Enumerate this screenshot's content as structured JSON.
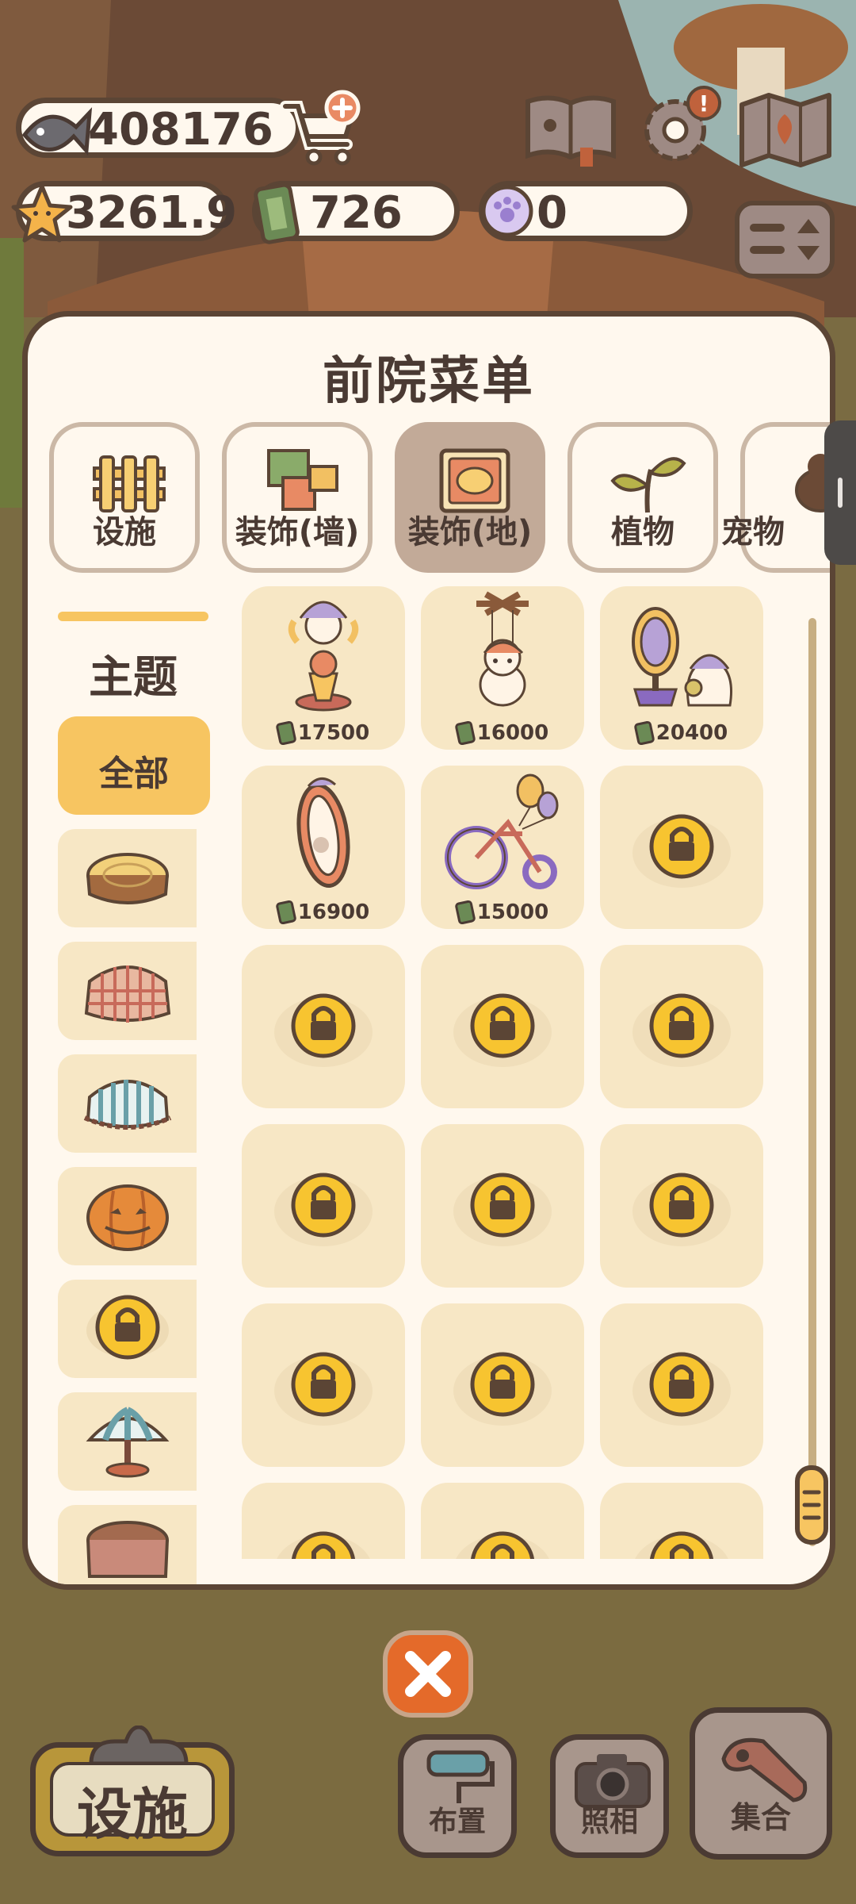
{
  "resources": {
    "fish": {
      "icon": "fish-icon",
      "value": "408176"
    },
    "star": {
      "icon": "star-icon",
      "value": "3261.9"
    },
    "ticket": {
      "icon": "ticket-icon",
      "value": "726"
    },
    "paw": {
      "icon": "paw-coin-icon",
      "value": "0"
    }
  },
  "top_buttons": [
    "shop-cart-button",
    "guide-book-button",
    "settings-button",
    "map-button",
    "sort-toggle-button"
  ],
  "panel": {
    "title": "前院菜单",
    "categories": [
      {
        "label": "设施",
        "icon": "fence-icon",
        "active": false
      },
      {
        "label": "装饰(墙)",
        "icon": "wall-decor-icon",
        "active": false
      },
      {
        "label": "装饰(地)",
        "icon": "rug-icon",
        "active": true
      },
      {
        "label": "植物",
        "icon": "sprout-icon",
        "active": false
      },
      {
        "label": "宠物",
        "icon": "pet-icon",
        "active": false
      }
    ],
    "theme": {
      "title": "主题",
      "items": [
        {
          "label": "全部",
          "icon": "",
          "active": true
        },
        {
          "label": "",
          "icon": "log-table-icon"
        },
        {
          "label": "",
          "icon": "checkered-table-icon"
        },
        {
          "label": "",
          "icon": "striped-table-icon"
        },
        {
          "label": "",
          "icon": "pumpkin-icon"
        },
        {
          "label": "",
          "icon": "lock-icon"
        },
        {
          "label": "",
          "icon": "umbrella-table-icon"
        },
        {
          "label": "",
          "icon": "brown-table-icon"
        }
      ]
    },
    "items": [
      {
        "name": "jester-cat-statue",
        "price": "17500",
        "locked": false
      },
      {
        "name": "puppet-cat",
        "price": "16000",
        "locked": false
      },
      {
        "name": "magic-mirror-ghost",
        "price": "20400",
        "locked": false
      },
      {
        "name": "oval-mirror",
        "price": "16900",
        "locked": false
      },
      {
        "name": "balloon-bicycle",
        "price": "15000",
        "locked": false
      },
      {
        "name": "locked-item",
        "price": "",
        "locked": true
      },
      {
        "name": "locked-item",
        "price": "",
        "locked": true
      },
      {
        "name": "locked-item",
        "price": "",
        "locked": true
      },
      {
        "name": "locked-item",
        "price": "",
        "locked": true
      },
      {
        "name": "locked-item",
        "price": "",
        "locked": true
      },
      {
        "name": "locked-item",
        "price": "",
        "locked": true
      },
      {
        "name": "locked-item",
        "price": "",
        "locked": true
      },
      {
        "name": "locked-item",
        "price": "",
        "locked": true
      },
      {
        "name": "locked-item",
        "price": "",
        "locked": true
      },
      {
        "name": "locked-item",
        "price": "",
        "locked": true
      },
      {
        "name": "locked-item",
        "price": "",
        "locked": true
      },
      {
        "name": "locked-item",
        "price": "",
        "locked": true
      },
      {
        "name": "locked-item",
        "price": "",
        "locked": true
      }
    ]
  },
  "bottom": {
    "facility_label": "设施",
    "layout_label": "布置",
    "photo_label": "照相",
    "gather_label": "集合",
    "close_icon": "close-icon"
  }
}
